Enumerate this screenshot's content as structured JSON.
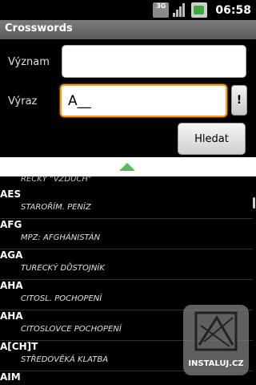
{
  "status_bar": {
    "network": "3G",
    "time": "06:58"
  },
  "app": {
    "title": "Crosswords"
  },
  "form": {
    "meaning_label": "Význam",
    "meaning_value": "",
    "term_label": "Výraz",
    "term_value": "A__",
    "bang_label": "!",
    "search_label": "Hledat"
  },
  "list": {
    "partial_def": "ŘECKY \"VZDUCH\"",
    "items": [
      {
        "word": "AES",
        "def": "STAROŘÍM. PENÍZ"
      },
      {
        "word": "AFG",
        "def": "MPZ: AFGHÁNISTÁN"
      },
      {
        "word": "AGA",
        "def": "TURECKÝ DŮSTOJNÍK"
      },
      {
        "word": "AHA",
        "def": "CITOSL. POCHOPENÍ"
      },
      {
        "word": "AHA",
        "def": "CITOSLOVCE POCHOPENÍ"
      },
      {
        "word": "A[CH]T",
        "def": "STŘEDOVĚKÁ KLATBA"
      },
      {
        "word": "AIM",
        "def": ""
      }
    ]
  },
  "watermark": {
    "text": "INSTALUJ.CZ"
  }
}
